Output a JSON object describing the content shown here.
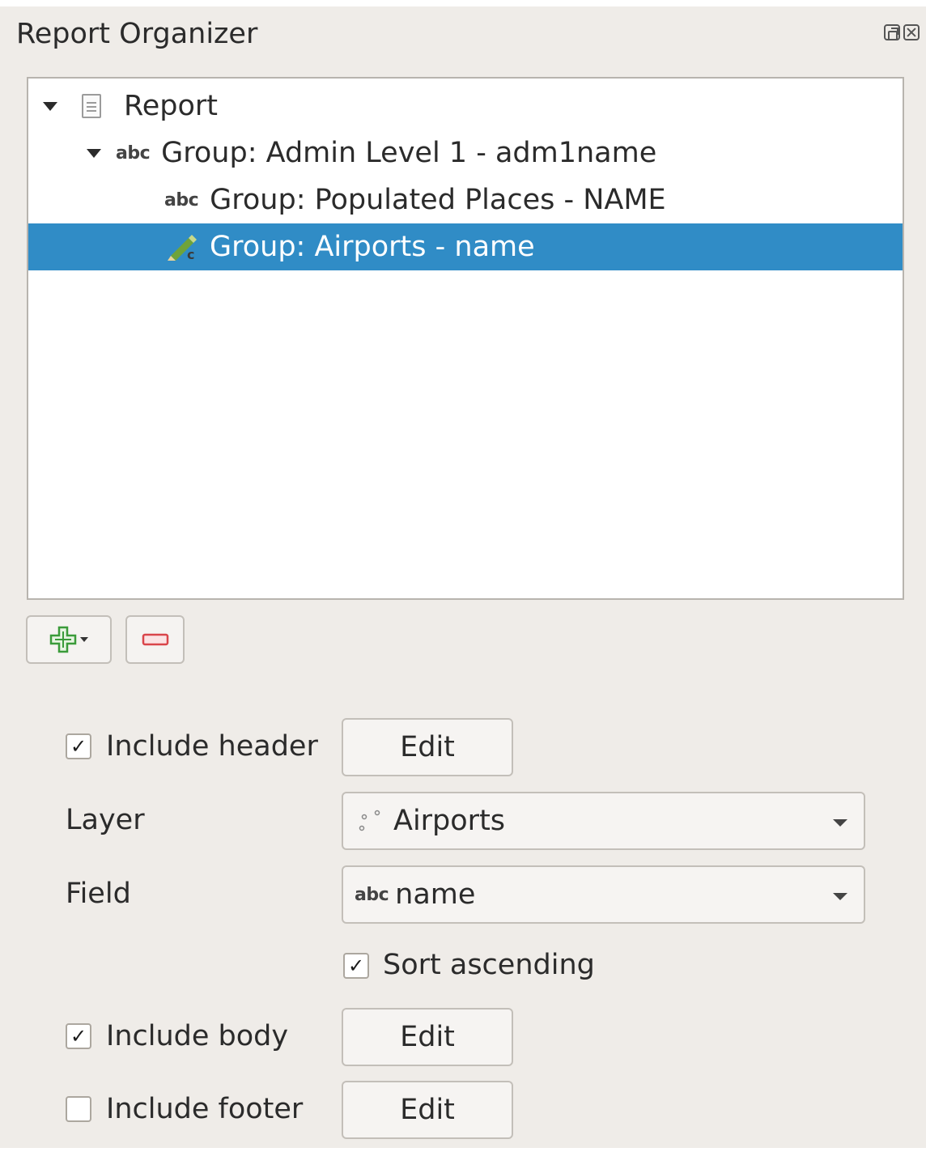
{
  "panel": {
    "title": "Report Organizer",
    "float_icon": "dock-float-icon",
    "close_icon": "close-icon"
  },
  "tree": {
    "items": [
      {
        "label": "Report",
        "icon": "report-document-icon",
        "expanded": true
      },
      {
        "label": "Group: Admin Level 1 - adm1name",
        "icon_text": "abc",
        "expanded": true
      },
      {
        "label": "Group: Populated Places - NAME",
        "icon_text": "abc"
      },
      {
        "label": "Group: Airports - name",
        "icon": "edit-pencil-icon",
        "selected": true
      }
    ]
  },
  "toolbar": {
    "add_icon": "add-plus-icon",
    "remove_icon": "remove-minus-icon"
  },
  "options": {
    "include_header": {
      "label": "Include header",
      "checked": true,
      "check": "✓"
    },
    "header_edit": "Edit",
    "layer_label": "Layer",
    "layer_value": "Airports",
    "layer_icon": "point-layer-icon",
    "field_label": "Field",
    "field_type": "abc",
    "field_value": "name",
    "sort_ascending": {
      "label": "Sort ascending",
      "checked": true,
      "check": "✓"
    },
    "include_body": {
      "label": "Include body",
      "checked": true,
      "check": "✓"
    },
    "body_edit": "Edit",
    "include_footer": {
      "label": "Include footer",
      "checked": false
    },
    "footer_edit": "Edit"
  },
  "colors": {
    "selection": "#308cc6",
    "panel_bg": "#efece8",
    "add_green": "#3a9b3a",
    "remove_red": "#d9454a"
  }
}
